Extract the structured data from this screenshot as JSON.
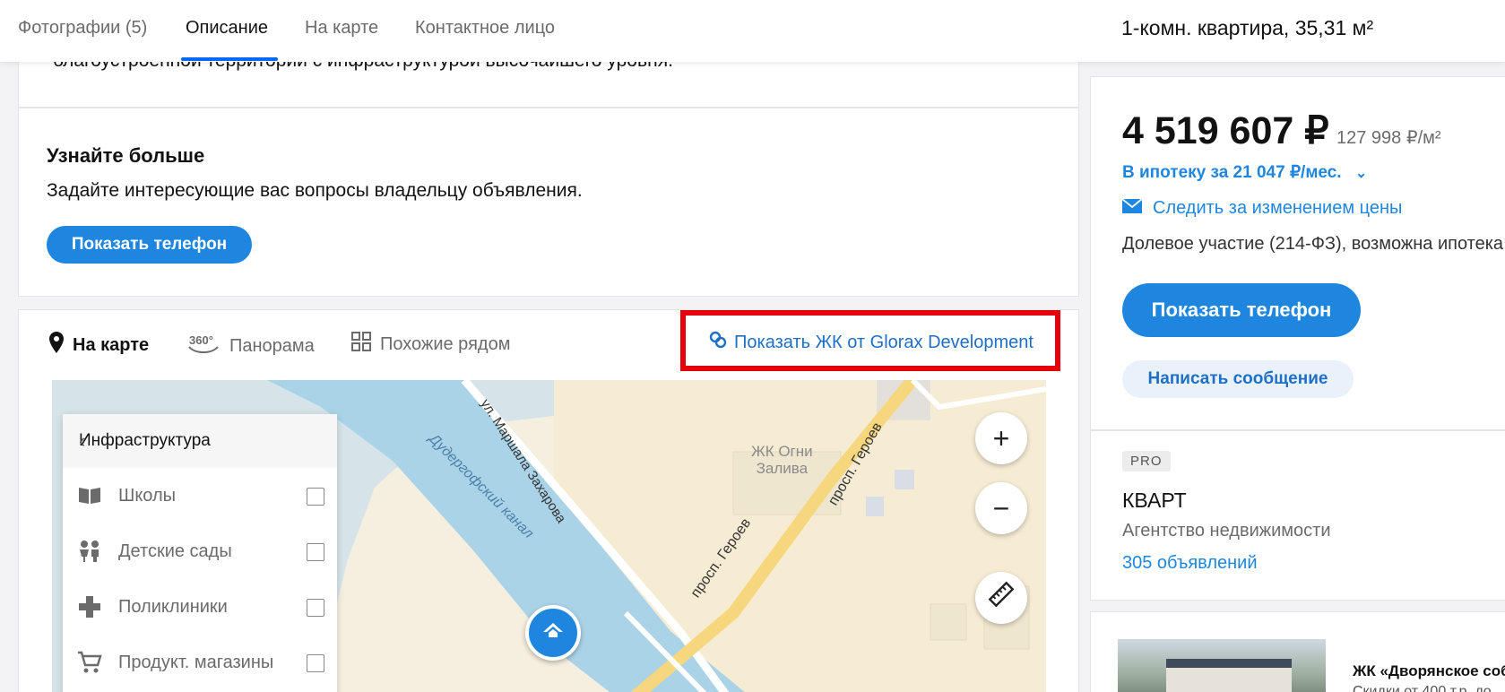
{
  "topnav": {
    "tabs": [
      {
        "label": "Фотографии (5)"
      },
      {
        "label": "Описание"
      },
      {
        "label": "На карте"
      },
      {
        "label": "Контактное лицо"
      }
    ],
    "flat_title": "1-комн. квартира, 35,31 м²"
  },
  "description": {
    "tail_text": "благоустроенной территории с инфраструктурой высочайшего уровня."
  },
  "learn_more": {
    "title": "Узнайте больше",
    "text": "Задайте интересующие вас вопросы владельцу объявления.",
    "phone_button": "Показать телефон"
  },
  "map_section": {
    "tabs": [
      {
        "label": "На карте",
        "icon": "location-pin-icon"
      },
      {
        "label": "Панорама",
        "icon": "panorama-360-icon"
      },
      {
        "label": "Похожие рядом",
        "icon": "grid-icon"
      }
    ],
    "gk_link": "Показать ЖК от Glorax Development",
    "labels": {
      "canal": "Дудергофский канал",
      "street1": "ул. Маршала Захарова",
      "street2": "просп. Героев",
      "street3": "просп. Героев",
      "complex": "ЖК Огни\nЗалива"
    },
    "infra_panel": {
      "title": "Инфраструктура",
      "items": [
        {
          "label": "Школы",
          "icon": "school-book-icon"
        },
        {
          "label": "Детские сады",
          "icon": "kids-icon"
        },
        {
          "label": "Поликлиники",
          "icon": "medical-cross-icon"
        },
        {
          "label": "Продукт. магазины",
          "icon": "shopping-cart-icon"
        }
      ]
    }
  },
  "price_card": {
    "price": "4 519 607 ₽",
    "price_per_m2": "127 998 ₽/м²",
    "mortgage": "В ипотеку за 21 047 ₽/мес.",
    "follow_price": "Следить за изменением цены",
    "deal_type": "Долевое участие (214-ФЗ), возможна ипотека",
    "phone_button": "Показать телефон",
    "message_button": "Написать сообщение"
  },
  "agency": {
    "badge": "PRO",
    "name": "КВАРТ",
    "type": "Агентство недвижимости",
    "ads": "305 объявлений"
  },
  "jk": {
    "title": "ЖК «Дворянское собрание»",
    "subtitle": "Скидки от 400 т.р. до"
  },
  "colors": {
    "accent": "#1f86e0",
    "link": "#1f6fc7",
    "highlight": "#e6000b"
  }
}
